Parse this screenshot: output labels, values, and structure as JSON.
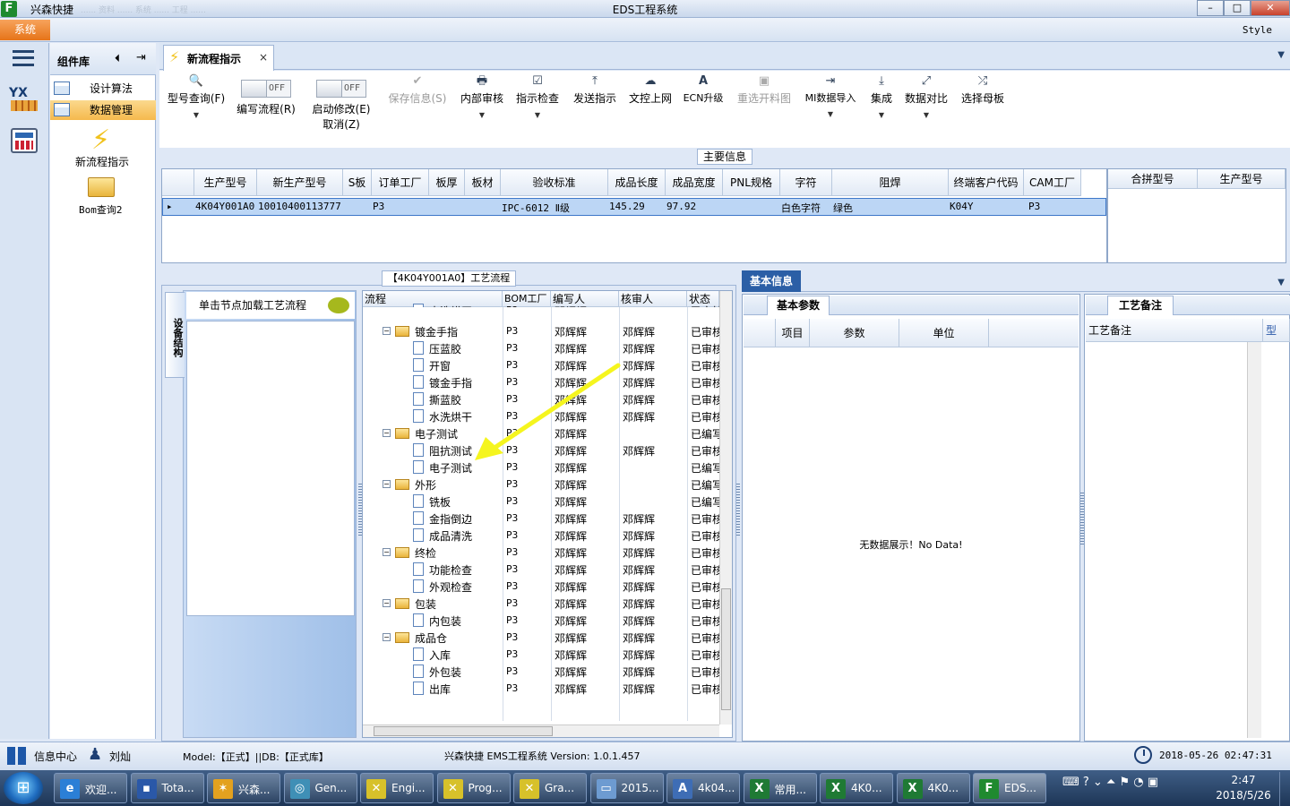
{
  "window": {
    "app_name": "兴森快捷",
    "title": "EDS工程系统",
    "blurred_menu": "...... 资料 ...... 系统 ...... 工程 ......",
    "min": "–",
    "max": "□",
    "close": "✕"
  },
  "menubar": {
    "system": "系统",
    "style": "Style"
  },
  "components": {
    "title": "组件库",
    "collapse": "⏴",
    "pin": "⇥",
    "items": [
      {
        "label": "设计算法"
      },
      {
        "label": "数据管理"
      }
    ],
    "new_flow": "新流程指示",
    "bom": "Bom查询2"
  },
  "tab": {
    "label": "新流程指示",
    "close": "×",
    "dropdown": "▼"
  },
  "toolbar": {
    "items": [
      {
        "icon": "🔍",
        "label": "型号查询(F)",
        "dd": "▼"
      },
      {
        "toggle": "OFF",
        "label": "编写流程(R)"
      },
      {
        "toggle": "OFF",
        "label": "启动修改(E)",
        "label2": "取消(Z)"
      },
      {
        "icon": "✔",
        "label": "保存信息(S)",
        "disabled": true
      },
      {
        "icon": "🖶",
        "label": "内部审核",
        "dd": "▼"
      },
      {
        "icon": "☑",
        "label": "指示检查",
        "dd": "▼"
      },
      {
        "icon": "⤒",
        "label": "发送指示"
      },
      {
        "icon": "☁",
        "label": "文控上网"
      },
      {
        "icon": "A",
        "label": "ECN升级"
      },
      {
        "icon": "▣",
        "label": "重选开料图",
        "disabled": true
      },
      {
        "icon": "⇥",
        "label": "MI数据导入",
        "dd": "▼"
      },
      {
        "icon": "⤓",
        "label": "集成",
        "dd": "▼"
      },
      {
        "icon": "⤢",
        "label": "数据对比",
        "dd": "▼"
      },
      {
        "icon": "⤮",
        "label": "选择母板"
      }
    ]
  },
  "main_info": {
    "title": "主要信息",
    "headers": [
      "生产型号",
      "新生产型号",
      "S板",
      "订单工厂",
      "板厚",
      "板材",
      "验收标准",
      "成品长度",
      "成品宽度",
      "PNL规格",
      "字符",
      "阻焊",
      "终端客户代码",
      "CAM工厂"
    ],
    "row": {
      "model": "4K04Y001A0",
      "new_model": "10010400113777",
      "factory": "P3",
      "standard": "IPC-6012 Ⅱ级",
      "length": "145.29",
      "width": "97.92",
      "char": "白色字符",
      "mask": "绿色",
      "customer": "K04Y",
      "cam": "P3",
      "indicator": "▸"
    },
    "side_headers": [
      "合拼型号",
      "生产型号"
    ]
  },
  "process": {
    "title": "【4K04Y001A0】工艺流程",
    "device_tab": "设备结构",
    "load_label": "单击节点加载工艺流程",
    "headers": [
      "流程",
      "BOM工厂",
      "编写人",
      "核审人",
      "状态"
    ],
    "rows": [
      {
        "name": "水洗烘干",
        "level": 2,
        "bom": "P3",
        "editor": "邓辉辉",
        "reviewer": "",
        "status": "已审核"
      },
      {
        "name": "镀金手指",
        "level": 1,
        "bom": "P3",
        "editor": "邓辉辉",
        "reviewer": "邓辉辉",
        "status": "已审核"
      },
      {
        "name": "压蓝胶",
        "level": 2,
        "bom": "P3",
        "editor": "邓辉辉",
        "reviewer": "邓辉辉",
        "status": "已审核"
      },
      {
        "name": "开窗",
        "level": 2,
        "bom": "P3",
        "editor": "邓辉辉",
        "reviewer": "邓辉辉",
        "status": "已审核"
      },
      {
        "name": "镀金手指",
        "level": 2,
        "bom": "P3",
        "editor": "邓辉辉",
        "reviewer": "邓辉辉",
        "status": "已审核"
      },
      {
        "name": "撕蓝胶",
        "level": 2,
        "bom": "P3",
        "editor": "邓辉辉",
        "reviewer": "邓辉辉",
        "status": "已审核"
      },
      {
        "name": "水洗烘干",
        "level": 2,
        "bom": "P3",
        "editor": "邓辉辉",
        "reviewer": "邓辉辉",
        "status": "已审核"
      },
      {
        "name": "电子测试",
        "level": 1,
        "bom": "P3",
        "editor": "邓辉辉",
        "reviewer": "",
        "status": "已编写"
      },
      {
        "name": "阻抗测试",
        "level": 2,
        "bom": "P3",
        "editor": "邓辉辉",
        "reviewer": "邓辉辉",
        "status": "已审核"
      },
      {
        "name": "电子测试",
        "level": 2,
        "bom": "P3",
        "editor": "邓辉辉",
        "reviewer": "",
        "status": "已编写"
      },
      {
        "name": "外形",
        "level": 1,
        "bom": "P3",
        "editor": "邓辉辉",
        "reviewer": "",
        "status": "已编写"
      },
      {
        "name": "铣板",
        "level": 2,
        "bom": "P3",
        "editor": "邓辉辉",
        "reviewer": "",
        "status": "已编写"
      },
      {
        "name": "金指倒边",
        "level": 2,
        "bom": "P3",
        "editor": "邓辉辉",
        "reviewer": "邓辉辉",
        "status": "已审核"
      },
      {
        "name": "成品清洗",
        "level": 2,
        "bom": "P3",
        "editor": "邓辉辉",
        "reviewer": "邓辉辉",
        "status": "已审核"
      },
      {
        "name": "终检",
        "level": 1,
        "bom": "P3",
        "editor": "邓辉辉",
        "reviewer": "邓辉辉",
        "status": "已审核"
      },
      {
        "name": "功能检查",
        "level": 2,
        "bom": "P3",
        "editor": "邓辉辉",
        "reviewer": "邓辉辉",
        "status": "已审核"
      },
      {
        "name": "外观检查",
        "level": 2,
        "bom": "P3",
        "editor": "邓辉辉",
        "reviewer": "邓辉辉",
        "status": "已审核"
      },
      {
        "name": "包装",
        "level": 1,
        "bom": "P3",
        "editor": "邓辉辉",
        "reviewer": "邓辉辉",
        "status": "已审核"
      },
      {
        "name": "内包装",
        "level": 2,
        "bom": "P3",
        "editor": "邓辉辉",
        "reviewer": "邓辉辉",
        "status": "已审核"
      },
      {
        "name": "成品仓",
        "level": 1,
        "bom": "P3",
        "editor": "邓辉辉",
        "reviewer": "邓辉辉",
        "status": "已审核"
      },
      {
        "name": "入库",
        "level": 2,
        "bom": "P3",
        "editor": "邓辉辉",
        "reviewer": "邓辉辉",
        "status": "已审核"
      },
      {
        "name": "外包装",
        "level": 2,
        "bom": "P3",
        "editor": "邓辉辉",
        "reviewer": "邓辉辉",
        "status": "已审核"
      },
      {
        "name": "出库",
        "level": 2,
        "bom": "P3",
        "editor": "邓辉辉",
        "reviewer": "邓辉辉",
        "status": "已审核"
      }
    ],
    "annotation_color": "#f5f51e"
  },
  "basic_info": {
    "title": "基本信息",
    "dropdown": "▼",
    "params_tab": "基本参数",
    "param_headers": [
      "项目",
      "参数",
      "单位"
    ],
    "no_data": "无数据展示！No Data!",
    "notes_tab": "工艺备注",
    "note_headers": [
      "工艺备注",
      "型"
    ]
  },
  "status": {
    "info_center": "信息中心",
    "user": "刘灿",
    "model": "Model:【正式】||DB:【正式库】",
    "product": "兴森快捷 EMS工程系统 Version: 1.0.1.457",
    "time": "2018-05-26 02:47:31"
  },
  "taskbar": {
    "start": "⊞",
    "items": [
      {
        "icon": "e",
        "label": "欢迎...",
        "color": "#2b7fd6"
      },
      {
        "icon": "▪",
        "label": "Tota...",
        "color": "#2a58a8"
      },
      {
        "icon": "✶",
        "label": "兴森...",
        "color": "#e3a11f"
      },
      {
        "icon": "◎",
        "label": "Gen...",
        "color": "#3f8fb6"
      },
      {
        "icon": "✕",
        "label": "Engi...",
        "color": "#d7c12a"
      },
      {
        "icon": "✕",
        "label": "Prog...",
        "color": "#d7c12a"
      },
      {
        "icon": "✕",
        "label": "Gra...",
        "color": "#d7c12a"
      },
      {
        "icon": "▭",
        "label": "2015...",
        "color": "#6d9bd1"
      },
      {
        "icon": "A",
        "label": "4k04...",
        "color": "#3e6db5"
      },
      {
        "icon": "X",
        "label": "常用...",
        "color": "#1f7a34"
      },
      {
        "icon": "X",
        "label": "4K0...",
        "color": "#1f7a34"
      },
      {
        "icon": "X",
        "label": "4K0...",
        "color": "#1f7a34"
      },
      {
        "icon": "F",
        "label": "EDS...",
        "color": "#1f8a2f"
      }
    ],
    "tray": "⌨ ? ⌄ ⏶ ⚑ ◔ ▣",
    "clock_time": "2:47",
    "clock_date": "2018/5/26"
  }
}
